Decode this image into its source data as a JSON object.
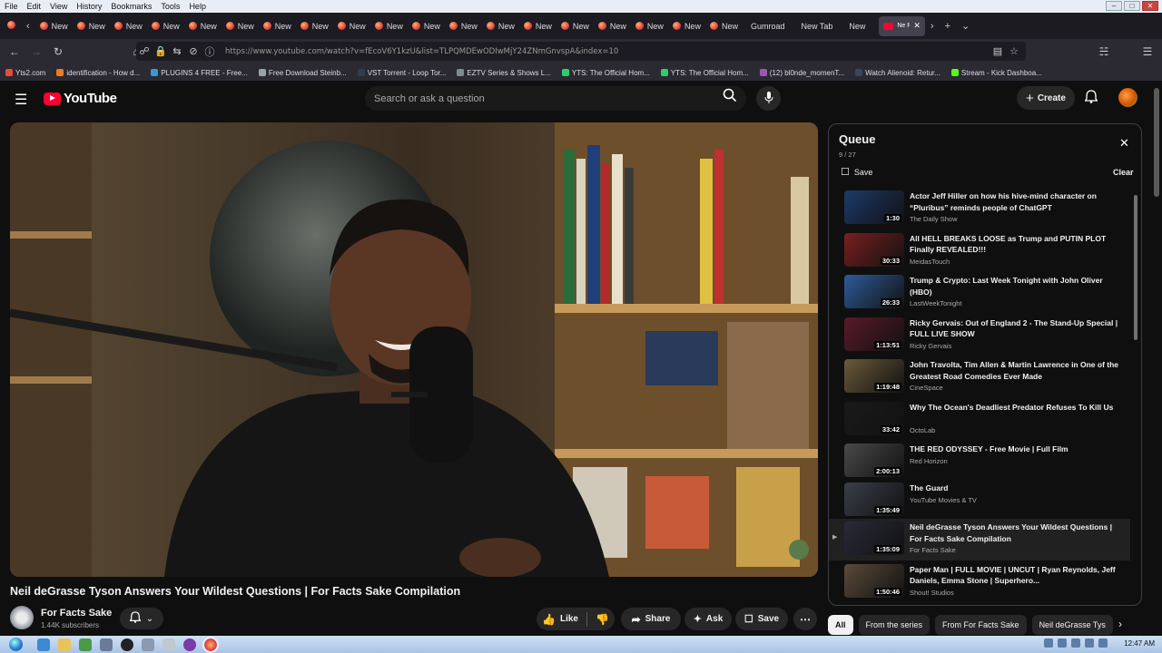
{
  "browser": {
    "menus": [
      "File",
      "Edit",
      "View",
      "History",
      "Bookmarks",
      "Tools",
      "Help"
    ],
    "tabs": [
      {
        "label": "New"
      },
      {
        "label": "New"
      },
      {
        "label": "New"
      },
      {
        "label": "New"
      },
      {
        "label": "New"
      },
      {
        "label": "New"
      },
      {
        "label": "New"
      },
      {
        "label": "New"
      },
      {
        "label": "New"
      },
      {
        "label": "New"
      },
      {
        "label": "New"
      },
      {
        "label": "New"
      },
      {
        "label": "New"
      },
      {
        "label": "New"
      },
      {
        "label": "New"
      },
      {
        "label": "New"
      },
      {
        "label": "New"
      },
      {
        "label": "New"
      },
      {
        "label": "New"
      }
    ],
    "plain_tabs": [
      "Gumroad",
      "New Tab",
      "New"
    ],
    "active_tab": "Ne Rul",
    "url": "https://www.youtube.com/watch?v=fEcoV6Y1kzU&list=TLPQMDEwODIwMjY24ZNmGnvspA&index=10",
    "bookmarks": [
      {
        "label": "Yts2.com",
        "color": "#e74c3c"
      },
      {
        "label": "identification - How d...",
        "color": "#e67e22"
      },
      {
        "label": "PLUGINS 4 FREE - Free...",
        "color": "#3498db"
      },
      {
        "label": "Free Download Steinb...",
        "color": "#95a5a6"
      },
      {
        "label": "VST Torrent - Loop Tor...",
        "color": "#2c3e50"
      },
      {
        "label": "EZTV Series & Shows L...",
        "color": "#7f8c8d"
      },
      {
        "label": "YTS: The Official Hom...",
        "color": "#2ecc71"
      },
      {
        "label": "YTS: The Official Hom...",
        "color": "#2ecc71"
      },
      {
        "label": "(12) bl0nde_momenT...",
        "color": "#9b59b6"
      },
      {
        "label": "Watch Alienoid: Retur...",
        "color": "#34495e"
      },
      {
        "label": "Stream - Kick Dashboa...",
        "color": "#53fc18"
      }
    ]
  },
  "youtube": {
    "logo_text": "YouTube",
    "search_placeholder": "Search or ask a question",
    "create_label": "Create"
  },
  "video": {
    "title": "Neil deGrasse Tyson Answers Your Wildest Questions | For Facts Sake Compilation",
    "channel": "For Facts Sake",
    "subscribers": "1.44K subscribers",
    "actions": {
      "like": "Like",
      "share": "Share",
      "ask": "Ask",
      "save": "Save"
    }
  },
  "queue": {
    "title": "Queue",
    "position": "9 / 27",
    "save_label": "Save",
    "clear_label": "Clear",
    "items": [
      {
        "title": "Actor Jeff Hiller on how his hive-mind character on “Pluribus” reminds people of ChatGPT",
        "channel": "The Daily Show",
        "duration": "1:30",
        "thumb_color": "#1d3a6b"
      },
      {
        "title": "All HELL BREAKS LOOSE as Trump and PUTIN PLOT Finally REVEALED!!!",
        "channel": "MeidasTouch",
        "duration": "30:33",
        "thumb_color": "#7a1f1f"
      },
      {
        "title": "Trump & Crypto: Last Week Tonight with John Oliver (HBO)",
        "channel": "LastWeekTonight",
        "duration": "26:33",
        "thumb_color": "#2e5b9a"
      },
      {
        "title": "Ricky Gervais: Out of England 2 - The Stand-Up Special | FULL LIVE SHOW",
        "channel": "Ricky Gervais",
        "duration": "1:13:51",
        "thumb_color": "#5a1a2a"
      },
      {
        "title": "John Travolta, Tim Allen & Martin Lawrence in One of the Greatest Road Comedies Ever Made",
        "channel": "CineSpace",
        "duration": "1:19:48",
        "thumb_color": "#6b5a3a"
      },
      {
        "title": "Why The Ocean's Deadliest Predator Refuses To Kill Us",
        "channel": "OctoLab",
        "duration": "33:42",
        "thumb_color": "#1a1a1a"
      },
      {
        "title": "THE RED ODYSSEY - Free Movie | Full Film",
        "channel": "Red Horizon",
        "duration": "2:00:13",
        "thumb_color": "#4a4a4a"
      },
      {
        "title": "The Guard",
        "channel": "YouTube Movies & TV",
        "duration": "1:35:49",
        "thumb_color": "#3a3f4a"
      },
      {
        "title": "Neil deGrasse Tyson Answers Your Wildest Questions | For Facts Sake Compilation",
        "channel": "For Facts Sake",
        "duration": "1:35:09",
        "thumb_color": "#2a2a3a",
        "active": true
      },
      {
        "title": "Paper Man | FULL MOVIE | UNCUT | Ryan Reynolds, Jeff Daniels, Emma Stone | Superhero...",
        "channel": "Shout! Studios",
        "duration": "1:50:46",
        "thumb_color": "#5a4a3a"
      }
    ]
  },
  "chips": [
    "All",
    "From the series",
    "From For Facts Sake",
    "Neil deGrasse Tys"
  ],
  "taskbar": {
    "clock": "12:47 AM"
  }
}
